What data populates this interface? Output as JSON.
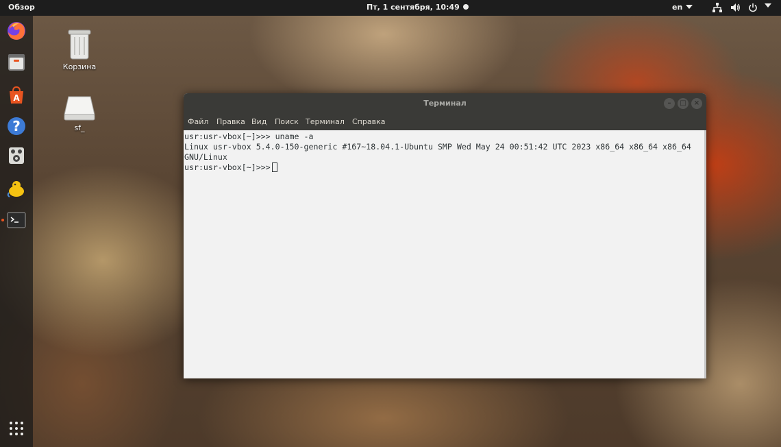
{
  "topbar": {
    "activities": "Обзор",
    "clock": "Пт, 1 сентября, 10:49",
    "language": "en"
  },
  "dock": {
    "apps": [
      "firefox-icon",
      "files-icon",
      "software-center-icon",
      "help-icon",
      "rhythmbox-icon",
      "sharing-icon",
      "terminal-icon"
    ],
    "show_apps": "show-applications-icon"
  },
  "desktop": {
    "trash_label": "Корзина",
    "drive_label": "sf_"
  },
  "terminal": {
    "title": "Терминал",
    "menu": [
      "Файл",
      "Правка",
      "Вид",
      "Поиск",
      "Терминал",
      "Справка"
    ],
    "lines": [
      "usr:usr-vbox[~]>>> uname -a",
      "Linux usr-vbox 5.4.0-150-generic #167~18.04.1-Ubuntu SMP Wed May 24 00:51:42 UTC 2023 x86_64 x86_64 x86_64",
      "GNU/Linux"
    ],
    "prompt": "usr:usr-vbox[~]>>>"
  },
  "colors": {
    "topbar": "#1d1d1d",
    "accent": "#e95420",
    "terminal_bg": "#f2f2f2",
    "titlebar": "#3a3a37"
  }
}
